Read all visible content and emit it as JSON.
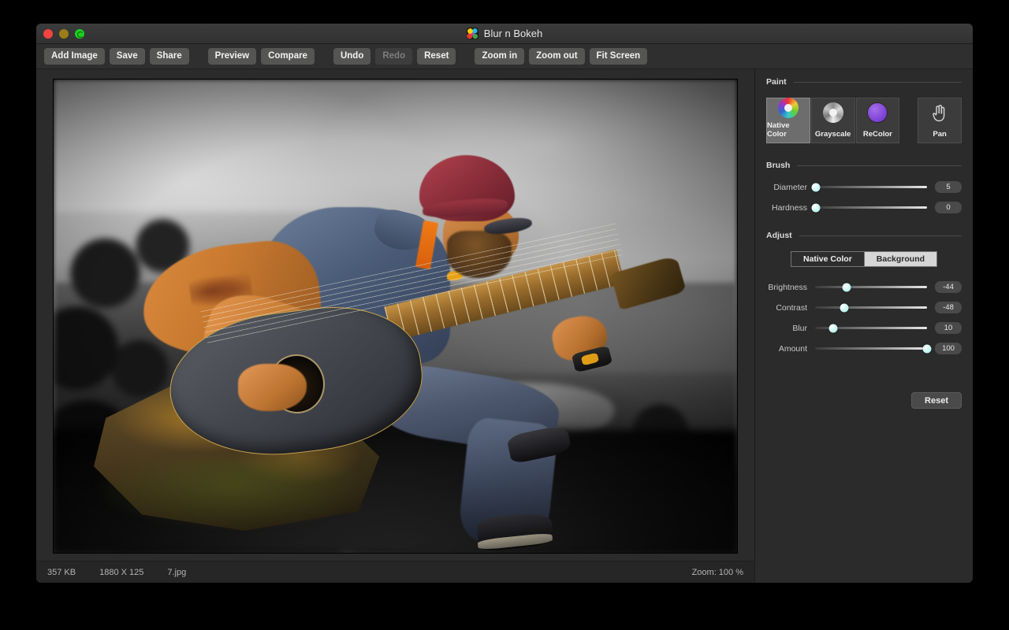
{
  "window": {
    "title": "Blur n Bokeh",
    "app_icon": "color-palette-icon",
    "controls": {
      "close": "close-button",
      "minimize": "minimize-button",
      "zoom": "zoom-button"
    }
  },
  "toolbar": {
    "groups": [
      {
        "buttons": [
          {
            "label": "Add Image",
            "name": "add-image-button",
            "disabled": false
          },
          {
            "label": "Save",
            "name": "save-button",
            "disabled": false
          },
          {
            "label": "Share",
            "name": "share-button",
            "disabled": false
          }
        ]
      },
      {
        "buttons": [
          {
            "label": "Preview",
            "name": "preview-button",
            "disabled": false
          },
          {
            "label": "Compare",
            "name": "compare-button",
            "disabled": false
          }
        ]
      },
      {
        "buttons": [
          {
            "label": "Undo",
            "name": "undo-button",
            "disabled": false
          },
          {
            "label": "Redo",
            "name": "redo-button",
            "disabled": true
          },
          {
            "label": "Reset",
            "name": "reset-button",
            "disabled": false
          }
        ]
      },
      {
        "buttons": [
          {
            "label": "Zoom in",
            "name": "zoom-in-button",
            "disabled": false
          },
          {
            "label": "Zoom out",
            "name": "zoom-out-button",
            "disabled": false
          },
          {
            "label": "Fit Screen",
            "name": "fit-screen-button",
            "disabled": false
          }
        ]
      }
    ]
  },
  "statusbar": {
    "file_size": "357 KB",
    "dimensions": "1880 X 125",
    "filename": "7.jpg",
    "zoom": "Zoom: 100 %"
  },
  "panel": {
    "paint": {
      "heading": "Paint",
      "tools": [
        {
          "label": "Native Color",
          "icon": "color-wheel-icon",
          "selected": true
        },
        {
          "label": "Grayscale",
          "icon": "grayscale-wheel-icon",
          "selected": false
        },
        {
          "label": "ReColor",
          "icon": "purple-circle-icon",
          "selected": false
        },
        {
          "label": "Pan",
          "icon": "hand-pan-icon",
          "selected": false
        }
      ]
    },
    "brush": {
      "heading": "Brush",
      "sliders": [
        {
          "label": "Diameter",
          "value": "5",
          "percent": 1
        },
        {
          "label": "Hardness",
          "value": "0",
          "percent": 1
        }
      ]
    },
    "adjust": {
      "heading": "Adjust",
      "segmented": [
        {
          "label": "Native Color",
          "selected": false
        },
        {
          "label": "Background",
          "selected": true
        }
      ],
      "sliders": [
        {
          "label": "Brightness",
          "value": "-44",
          "percent": 28
        },
        {
          "label": "Contrast",
          "value": "-48",
          "percent": 26
        },
        {
          "label": "Blur",
          "value": "10",
          "percent": 16
        },
        {
          "label": "Amount",
          "value": "100",
          "percent": 100
        }
      ],
      "reset_label": "Reset"
    }
  },
  "colors": {
    "window_bg": "#2b2b2b",
    "toolbar_bg": "#2f2f2f",
    "button_bg": "#555554",
    "accent_knob": "#b9f3ee",
    "recolor_swatch": "#7b3fd4",
    "segment_selected_bg": "#d6d6d6"
  },
  "canvas": {
    "name": "image-canvas",
    "description": "Selective-color photo: man in red beanie and navy polo playing acoustic guitar on a mossy rock, grayscale blurred lake and hills background"
  }
}
